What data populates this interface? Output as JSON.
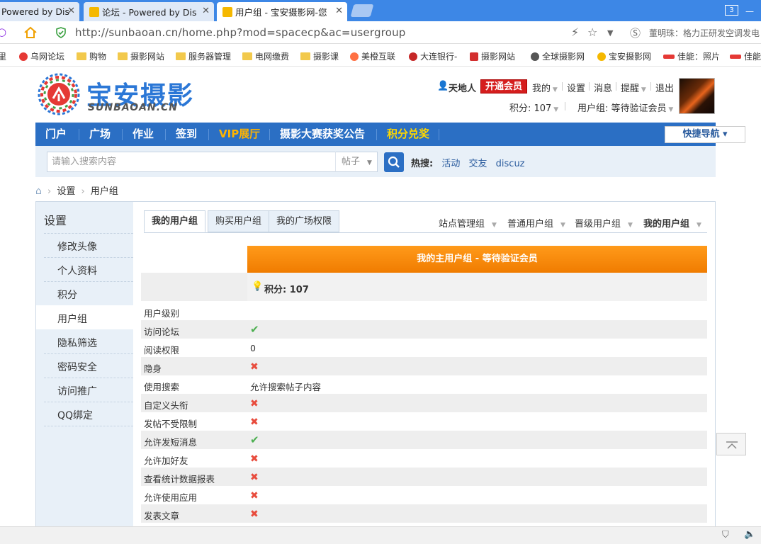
{
  "browser": {
    "tabs": [
      {
        "title": "Powered by Dis"
      },
      {
        "title": "论坛 - Powered by Dis"
      },
      {
        "title": "用户组 - 宝安摄影网-您"
      }
    ],
    "tab_count": "3",
    "url": "http://sunbaoan.cn/home.php?mod=spacecp&ac=usergroup",
    "extension_text": "董明珠：格力正研发空调发电",
    "bookmarks": [
      "乌网论坛",
      "购物",
      "摄影网站",
      "服务器管理",
      "电网缴费",
      "摄影课",
      "美橙互联",
      "大连银行-",
      "摄影网站",
      "全球摄影网",
      "宝安摄影网",
      "佳能：照片",
      "佳能"
    ]
  },
  "site": {
    "logo_text": "宝安摄影",
    "logo_sub": "SUNBAOAN.CN"
  },
  "user": {
    "name": "天地人",
    "vip_button": "开通会员",
    "links": [
      "我的",
      "设置",
      "消息",
      "提醒",
      "退出"
    ],
    "points": "积分: 107",
    "group": "用户组: 等待验证会员"
  },
  "nav": {
    "items": [
      "门户",
      "广场",
      "作业",
      "签到",
      "VIP展厅",
      "摄影大赛获奖公告",
      "积分兑奖"
    ],
    "quick_nav": "快捷导航 ▾"
  },
  "search": {
    "placeholder": "请输入搜索内容",
    "type": "帖子",
    "hot_label": "热搜:",
    "hot_items": [
      "活动",
      "交友",
      "discuz"
    ]
  },
  "breadcrumb": [
    "设置",
    "用户组"
  ],
  "sidebar": {
    "title": "设置",
    "items": [
      "修改头像",
      "个人资料",
      "积分",
      "用户组",
      "隐私筛选",
      "密码安全",
      "访问推广",
      "QQ绑定"
    ]
  },
  "tabs": [
    "我的用户组",
    "购买用户组",
    "我的广场权限"
  ],
  "group_menus": [
    "站点管理组",
    "普通用户组",
    "晋级用户组",
    "我的用户组"
  ],
  "main": {
    "header": "我的主用户组 - 等待验证会员",
    "points": "积分: 107",
    "rows": [
      {
        "label": "用户级别",
        "value": "",
        "status": ""
      },
      {
        "label": "访问论坛",
        "value": "",
        "status": "yes"
      },
      {
        "label": "阅读权限",
        "value": "0",
        "status": ""
      },
      {
        "label": "隐身",
        "value": "",
        "status": "no"
      },
      {
        "label": "使用搜索",
        "value": "允许搜索帖子内容",
        "status": ""
      },
      {
        "label": "自定义头衔",
        "value": "",
        "status": "no"
      },
      {
        "label": "发帖不受限制",
        "value": "",
        "status": "no"
      },
      {
        "label": "允许发短消息",
        "value": "",
        "status": "yes"
      },
      {
        "label": "允许加好友",
        "value": "",
        "status": "no"
      },
      {
        "label": "查看统计数据报表",
        "value": "",
        "status": "no"
      },
      {
        "label": "允许使用应用",
        "value": "",
        "status": "no"
      },
      {
        "label": "发表文章",
        "value": "",
        "status": "no"
      }
    ]
  },
  "colors": {
    "nav_blue": "#2b6fc4",
    "orange": "#f08a00",
    "vip_red": "#d51e1e",
    "yes_green": "#4caf50",
    "no_red": "#e84c3d"
  }
}
